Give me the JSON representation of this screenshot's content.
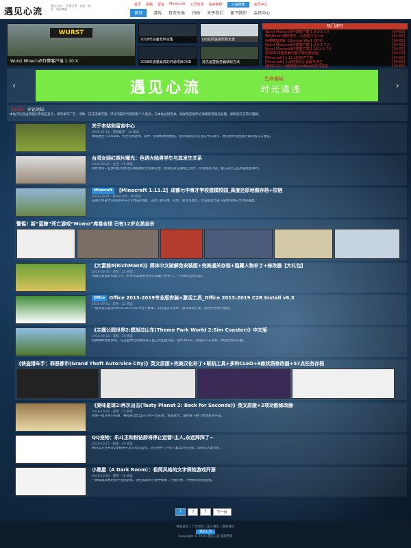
{
  "site": {
    "logo": "遇见心流",
    "tagline": "遇见心流 — 资源分享 · 游戏 · 软件 · 原创博客"
  },
  "top_nav": [
    "首页",
    "投稿",
    "留言",
    "Minecraft",
    "心灵鸡汤",
    "站内推荐",
    "公益搜索",
    "会员中心"
  ],
  "main_nav": [
    "首页",
    "游戏",
    "日志分类",
    "归档",
    "关于我们",
    "留下脚印",
    "会员中心"
  ],
  "featured": {
    "main_caption": "Wurst Minecraft作弊客户端 1.10.X",
    "main_logo": "WURST",
    "small": [
      "2018年必备软件合集",
      "QQ空间说说代码大全",
      "2018年流量最高的开源项目CMD",
      "抢先运营服务器获取方法"
    ]
  },
  "hot": {
    "title": "热门排行",
    "items": [
      {
        "text": "Wurst Minecraft作弊客户端 1.9.X-1.7.X",
        "date": "[04-05]"
      },
      {
        "text": "曝光Email 被封账号，心流的冷冷人间",
        "date": "[04-05]"
      },
      {
        "text": "网络推理游戏【Shadow War】(影子)",
        "date": "[04-05]"
      },
      {
        "text": "Wurst Minecraft作弊客户端 1.9.X-1.7.X",
        "date": "[04-05]"
      },
      {
        "text": "Wurst Minecraft作弊客户端 1.10.X-1.7.X",
        "date": "[04-05]"
      },
      {
        "text": "如何MC日服务器与客户端对接原理",
        "date": "[04-05]"
      },
      {
        "text": "[Minecraft] 1.12.2的文件下载",
        "date": "[04-05]"
      },
      {
        "text": "[Minecraft] 小米的双元小说版与天生",
        "date": "[04-05]"
      },
      {
        "text": "[转转工具] 一键修改Sandbox的文件信息",
        "date": "[04-05]"
      }
    ]
  },
  "banner": {
    "big": "遇见心流",
    "r1": "生命暴缺",
    "r2": "时光清浅"
  },
  "notice": {
    "tag": "【公告】",
    "title": "评论须知",
    "text": "本站评论区由管理员审核后显示，请勿发布广告、涉政、违法违规内容。评论内容仅代表网友个人观点，与本站立场无关。如发现违规评论请联系管理员处理，感谢您的支持与理解。"
  },
  "posts": [
    {
      "cat": "",
      "title": "关于本站和留言中心",
      "meta": "2018-07-12  · 游戏推荐 · 14 阅读",
      "excerpt": "本站建立于2018年，专注分享游戏、软件、资源和原创博客。任何问题可以在留言中心发布，我们会尽快回复大家的留言与建议。"
    },
    {
      "cat": "",
      "title": "台湾女网红照片曝光：色诱大陆男学生与其发生关系",
      "meta": "2018-08-26  · 生活 · 15 阅读",
      "excerpt": "网传台湾一名女网红利用社交网络接近大陆男学生，相关照片在网络上流传，引发网友热议。警方表示正在调查相关事件。"
    },
    {
      "cat": "Minecraft",
      "title": "【Minecraft 1.11.2】成都七中育才学校建模校园_高度还原地图存档+拉链",
      "meta": "2018-09-01  · Minecraft · 18 阅读",
      "excerpt": "成都七中育才学校的Minecraft校园地图，还原了教学楼、操场、食堂等建筑，欢迎各位玩家下载体验并分享你的截图。"
    },
    {
      "cat": "Office",
      "title": "Office 2013-2019专业版安装+激活工具_Office 2013-2019 C2R Install v6.3",
      "meta": "2018-09-10  · 软件 · 22 阅读",
      "excerpt": "一键安装与激活Office 2013-2019各个版本，支持自定义组件，操作简单方便，适合所有用户使用。"
    },
    {
      "cat": "",
      "title": "《主题公园世界2:模拟过山车(Theme Park World 2:Sim Coaster)》中文版",
      "meta": "2018-09-18  · 游戏 · 20 阅读",
      "excerpt": "经典模拟经营游戏，在这里你可以建造属于自己的主题公园，设计过山车，管理员工与游客，体验经营的乐趣。"
    },
    {
      "cat": "",
      "title": "《美味星球2:再次出击(Tasty Planet 2: Back for Seconds)》英文原版+2项功能修改器",
      "meta": "2018-10-02  · 游戏 · 12 阅读",
      "excerpt": "控制一团灰色小东西，吞噬身边比自己小的一切东西，逐渐变大，最终吞下整个地球甚至宇宙。"
    },
    {
      "cat": "",
      "title": "QQ宠物：乐斗正和粉钻即将停止运营!主人,永远拜拜了~",
      "meta": "2018-10-15  · 新闻 · 30 阅读",
      "excerpt": "腾讯官方宣布QQ宠物将于近日停止运营，这只陪伴了许多人童年的小企鹅，即将与大家告别。"
    },
    {
      "cat": "",
      "title": "小黑屋（A Dark Room）：极简风格的文字探险游戏开源",
      "meta": "2018-10-20  · 游戏 · 16 阅读",
      "excerpt": "一款极简风格的文字冒险游戏，你在黑暗的小屋中醒来，点燃火堆，开始你的冒险旅程。"
    }
  ],
  "wide_posts": [
    {
      "cat": "",
      "title": "警惕！新“蓝鲸”死亡游戏“Momo”席卷全球 已有12岁女孩自杀",
      "excerpt": "近日，一款名为Momo的挑战游戏在WhatsApp等社交平台上流传，请家长注意孩子的网络使用情况。"
    },
    {
      "cat": "",
      "title": "《侠盗猎车手：罪恶都市(Grand Theft Auto:Vice City)》英文原版+完美汉化补丁+联机工具+多种CLEO+8款优质修改器+57点任务存档",
      "excerpt": "经典开放世界动作游戏，附带汉化补丁与多种修改器，重温八十年代的罪恶都市。"
    }
  ],
  "mid_post": {
    "cat": "",
    "title": "《大富翁8(RichMan8)》简体中文破解免安装版+完美通关存档+隐藏人物补丁+修改器【大礼包】",
    "meta": "2018-08-30  · 游戏 · 24 阅读",
    "excerpt": "经典大富翁系列第八代，附带完美通关存档与隐藏人物补丁，一次畅玩全部内容。"
  },
  "pagination": [
    "1",
    "2",
    "3",
    "下一页"
  ],
  "footer": {
    "line1": "网站首页 | 广告合作 | 加入我们 | 联系我们",
    "badge": "遇见心流",
    "line2": "Copyright © 2018 遇见心流 版权所有"
  },
  "colors": {
    "accent": "#2d8fdb",
    "hot": "#c0392b",
    "banner": "#79ea45"
  }
}
